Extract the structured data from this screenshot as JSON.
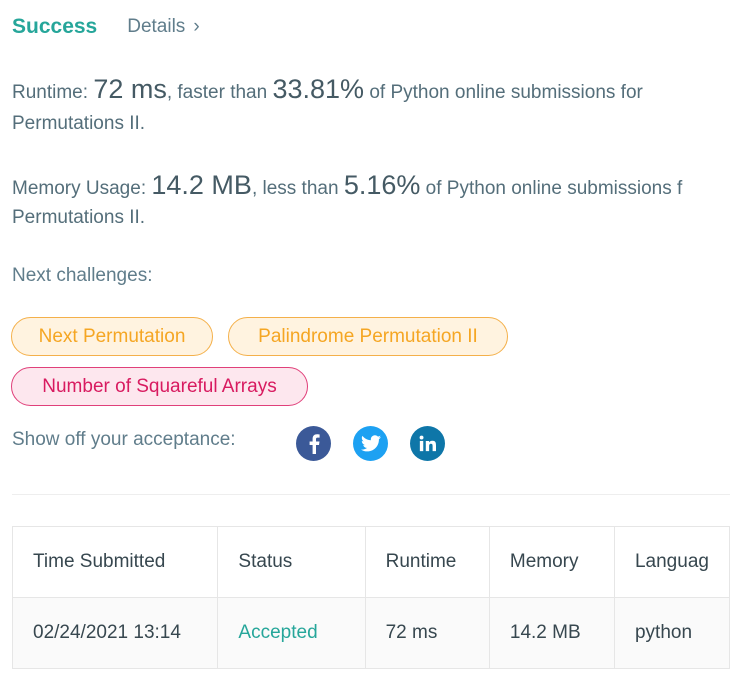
{
  "header": {
    "status": "Success",
    "details_label": "Details",
    "chevron": "›"
  },
  "runtime": {
    "label": "Runtime: ",
    "value": "72 ms",
    "mid_text": ", faster than ",
    "percent": "33.81%",
    "tail_text": " of Python online submissions for",
    "problem_line": "Permutations II."
  },
  "memory": {
    "label": "Memory Usage: ",
    "value": "14.2 MB",
    "mid_text": ", less than ",
    "percent": "5.16%",
    "tail_text": " of Python online submissions f",
    "problem_line": "Permutations II."
  },
  "next_challenges": {
    "label": "Next challenges:",
    "items": [
      {
        "label": "Next Permutation",
        "difficulty": "medium"
      },
      {
        "label": "Palindrome Permutation II",
        "difficulty": "medium"
      },
      {
        "label": "Number of Squareful Arrays",
        "difficulty": "hard"
      }
    ]
  },
  "share": {
    "label": "Show off your acceptance:",
    "icons": [
      "facebook-icon",
      "twitter-icon",
      "linkedin-icon"
    ]
  },
  "submissions": {
    "headers": [
      "Time Submitted",
      "Status",
      "Runtime",
      "Memory",
      "Languag"
    ],
    "rows": [
      [
        "02/24/2021 13:14",
        "Accepted",
        "72 ms",
        "14.2 MB",
        "python"
      ]
    ]
  },
  "colors": {
    "success": "#26a69a",
    "medium": "#f5a623",
    "hard": "#d81b60",
    "facebook": "#3b5998",
    "twitter": "#1da1f2",
    "linkedin": "#0e76a8"
  }
}
